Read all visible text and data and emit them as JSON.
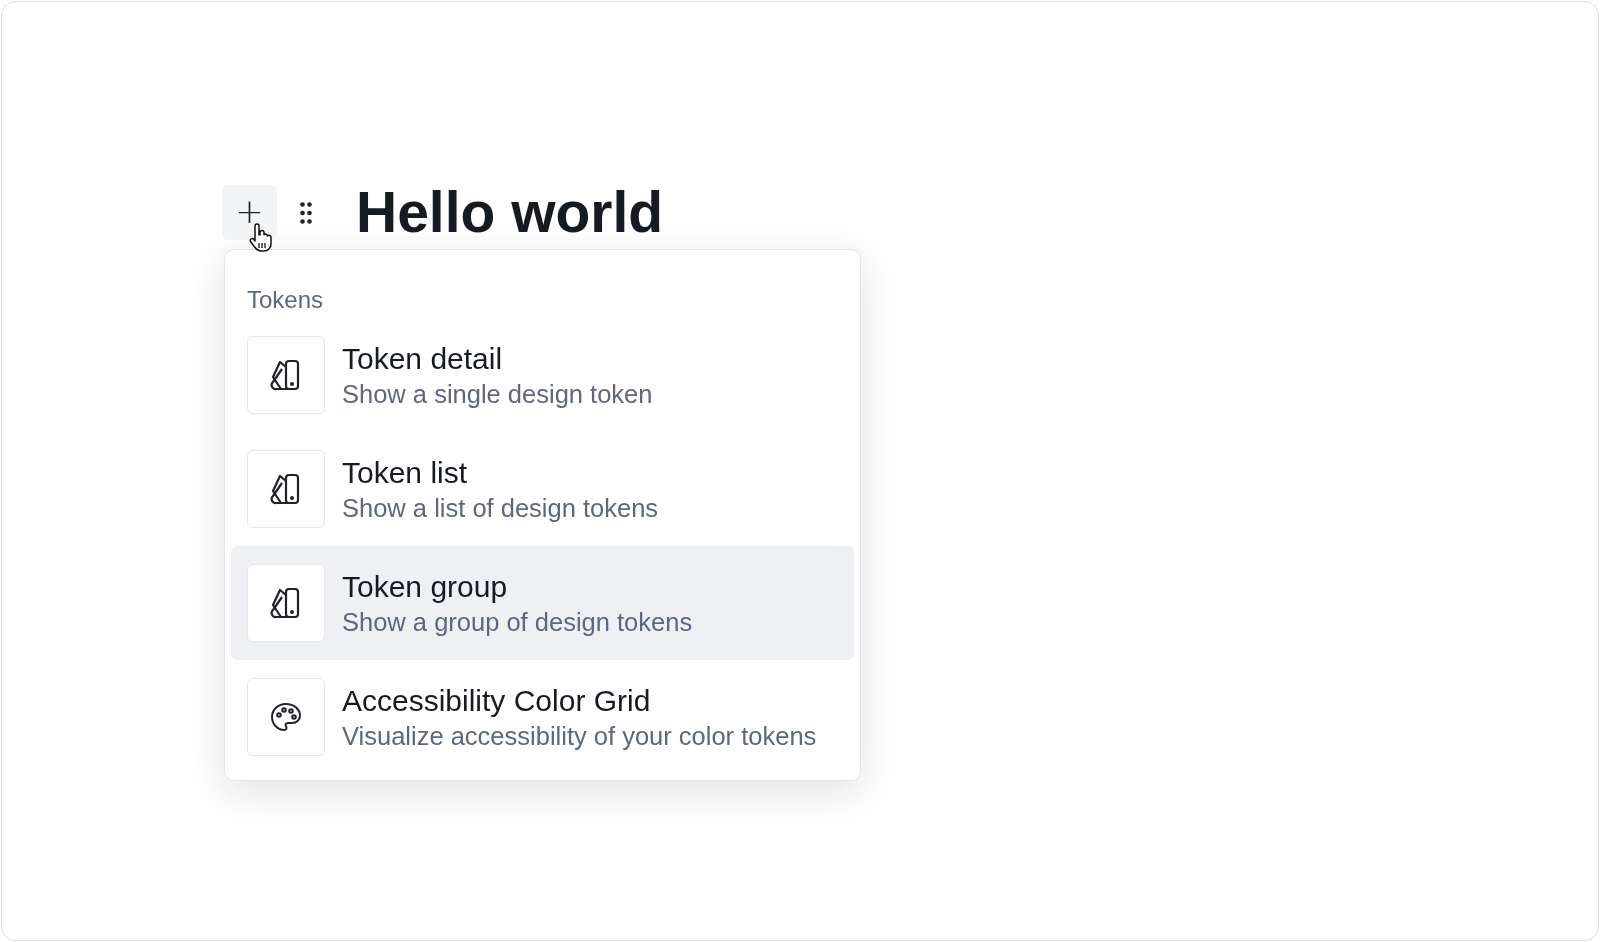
{
  "add_button": {
    "label": "+"
  },
  "heading": "Hello world",
  "menu": {
    "section_title": "Tokens",
    "items": [
      {
        "kind": "swatch",
        "title": "Token detail",
        "description": "Show a single design token",
        "selected": false
      },
      {
        "kind": "swatch",
        "title": "Token list",
        "description": "Show a list of design tokens",
        "selected": false
      },
      {
        "kind": "swatch",
        "title": "Token group",
        "description": "Show a group of design tokens",
        "selected": true
      },
      {
        "kind": "palette",
        "title": "Accessibility Color Grid",
        "description": "Visualize accessibility of your color tokens",
        "selected": false
      }
    ]
  }
}
